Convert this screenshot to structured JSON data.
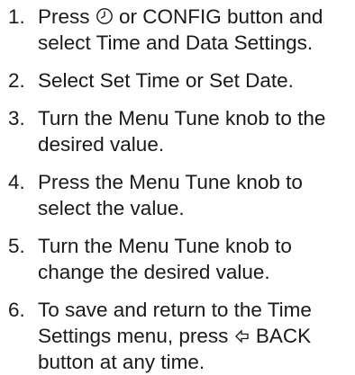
{
  "steps": [
    {
      "number": "1.",
      "line1_before_icon": "Press ",
      "icon": "clock-icon",
      "line1_after_icon": " or CONFIG button and",
      "line2": "select Time and Data Settings."
    },
    {
      "number": "2.",
      "line1": "Select Set Time or Set Date."
    },
    {
      "number": "3.",
      "line1": "Turn the Menu Tune knob to the",
      "line2": "desired value."
    },
    {
      "number": "4.",
      "line1": "Press the Menu Tune knob to",
      "line2": "select the value."
    },
    {
      "number": "5.",
      "line1": "Turn the Menu Tune knob to",
      "line2": "change the desired value."
    },
    {
      "number": "6.",
      "line1": "To save and return to the Time",
      "line2_before_icon": "Settings menu, press ",
      "icon": "back-arrow-icon",
      "line2_after_icon": "BACK",
      "line3": "button at any time."
    }
  ]
}
